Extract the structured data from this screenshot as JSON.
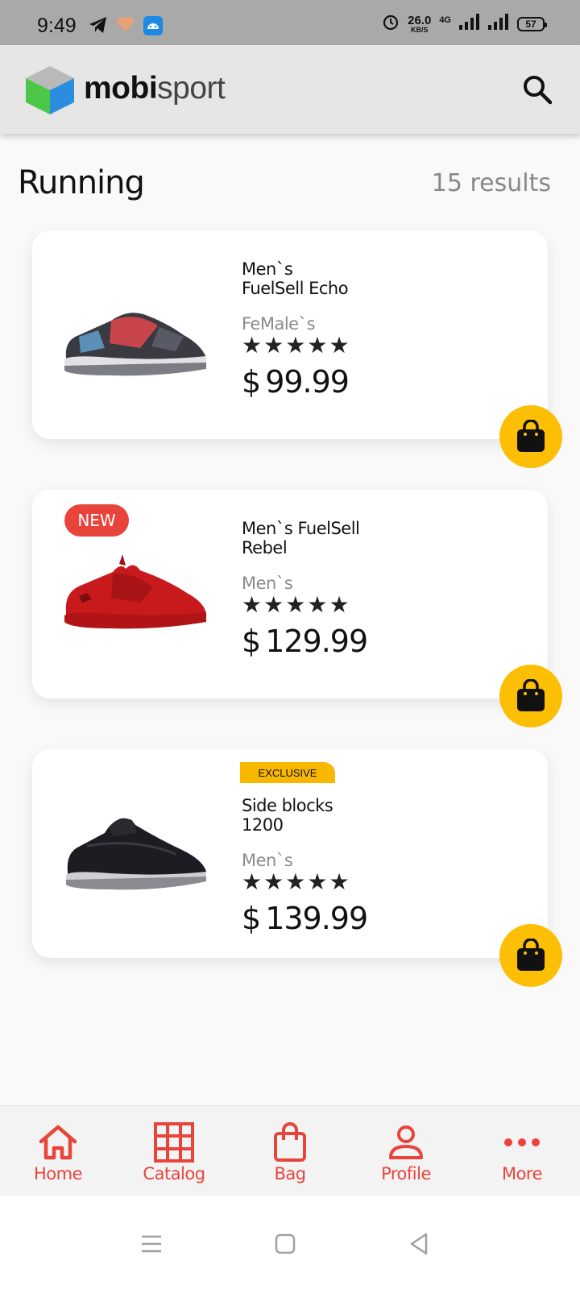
{
  "status_bar": {
    "time": "9:49",
    "net_speed": "26.0",
    "net_unit": "KB/S",
    "net_type": "4G",
    "battery": "57"
  },
  "app_bar": {
    "brand_bold": "mobi",
    "brand_light": "sport"
  },
  "page": {
    "title": "Running",
    "results_count": "15",
    "results_label": "results"
  },
  "products": [
    {
      "name": "Men`s\nFuelSell Echo",
      "gender": "FeMale`s",
      "rating": 5,
      "currency": "$",
      "price": "99.99",
      "badge": ""
    },
    {
      "name": "Men`s FuelSell\nRebel",
      "gender": "Men`s",
      "rating": 5,
      "currency": "$",
      "price": "129.99",
      "badge": "NEW"
    },
    {
      "name": "Side blocks\n1200",
      "gender": "Men`s",
      "rating": 5,
      "currency": "$",
      "price": "139.99",
      "badge": "EXCLUSIVE"
    }
  ],
  "bottom_nav": [
    {
      "label": "Home",
      "icon": "home-icon"
    },
    {
      "label": "Catalog",
      "icon": "grid-icon"
    },
    {
      "label": "Bag",
      "icon": "bag-icon"
    },
    {
      "label": "Profile",
      "icon": "profile-icon"
    },
    {
      "label": "More",
      "icon": "more-dots-icon"
    }
  ],
  "colors": {
    "accent": "#e8443b",
    "fab": "#fdbe06",
    "exclusive": "#f8b800"
  }
}
